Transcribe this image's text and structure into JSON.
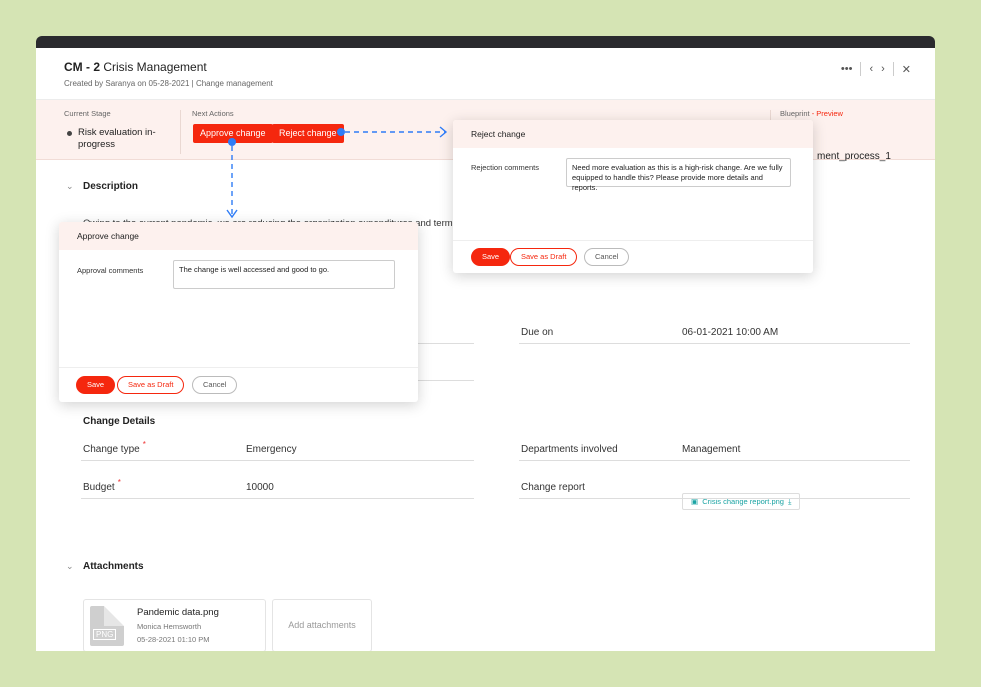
{
  "header": {
    "id": "CM - 2",
    "title": "Crisis Management",
    "subtitle": "Created by Saranya on 05-28-2021 | Change management",
    "more": "•••",
    "prev": "‹",
    "next": "›",
    "close": "✕"
  },
  "stage": {
    "current_label": "Current Stage",
    "current_value": "Risk evaluation in-progress",
    "next_label": "Next Actions",
    "approve": "Approve change",
    "reject": "Reject change",
    "blueprint_label": "Blueprint",
    "preview": "- Preview",
    "blueprint_value": "ment_process_1"
  },
  "description": {
    "heading": "Description",
    "text": "Owing to the current pandemic, we are reducing the organization expenditures and termin"
  },
  "schedule": {
    "due_label": "Due on",
    "due_value": "06-01-2021 10:00 AM"
  },
  "change_details": {
    "heading": "Change Details",
    "type_label": "Change type",
    "type_value": "Emergency",
    "budget_label": "Budget",
    "budget_value": "10000",
    "dept_label": "Departments involved",
    "dept_value": "Management",
    "report_label": "Change report",
    "report_file": "Crisis change report.png"
  },
  "attachments": {
    "heading": "Attachments",
    "file_name": "Pandemic data.png",
    "file_ext": "PNG",
    "file_owner": "Monica Hemsworth",
    "file_date": "05-28-2021 01:10 PM",
    "add_label": "Add attachments"
  },
  "approve_dialog": {
    "title": "Approve change",
    "label": "Approval comments",
    "comment": "The change is well accessed and good to go.",
    "save": "Save",
    "draft": "Save as Draft",
    "cancel": "Cancel"
  },
  "reject_dialog": {
    "title": "Reject change",
    "label": "Rejection comments",
    "comment": "Need more evaluation as this is a high-risk change. Are we fully equipped to handle this? Please provide more details and reports.",
    "save": "Save",
    "draft": "Save as Draft",
    "cancel": "Cancel"
  },
  "colors": {
    "accent": "#f5270e",
    "background": "#d5e4b4",
    "connector": "#2f7cf6",
    "link": "#1aa3a3"
  }
}
